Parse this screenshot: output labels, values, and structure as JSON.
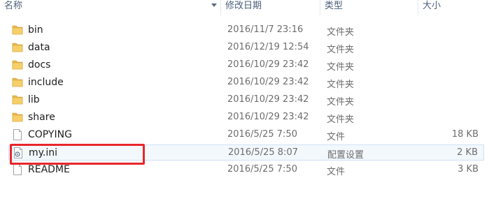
{
  "columns": {
    "name": "名称",
    "date": "修改日期",
    "type": "类型",
    "size": "大小"
  },
  "files": [
    {
      "name": "bin",
      "date": "2016/11/7 23:16",
      "type": "文件夹",
      "size": "",
      "icon": "folder-icon"
    },
    {
      "name": "data",
      "date": "2016/12/19 12:54",
      "type": "文件夹",
      "size": "",
      "icon": "folder-icon"
    },
    {
      "name": "docs",
      "date": "2016/10/29 23:42",
      "type": "文件夹",
      "size": "",
      "icon": "folder-icon"
    },
    {
      "name": "include",
      "date": "2016/10/29 23:42",
      "type": "文件夹",
      "size": "",
      "icon": "folder-icon"
    },
    {
      "name": "lib",
      "date": "2016/10/29 23:42",
      "type": "文件夹",
      "size": "",
      "icon": "folder-icon"
    },
    {
      "name": "share",
      "date": "2016/10/29 23:42",
      "type": "文件夹",
      "size": "",
      "icon": "folder-icon"
    },
    {
      "name": "COPYING",
      "date": "2016/5/25 7:50",
      "type": "文件",
      "size": "18 KB",
      "icon": "file-icon"
    },
    {
      "name": "my.ini",
      "date": "2016/5/25 8:07",
      "type": "配置设置",
      "size": "2 KB",
      "icon": "config-file-icon"
    },
    {
      "name": "README",
      "date": "2016/5/25 7:50",
      "type": "文件",
      "size": "3 KB",
      "icon": "file-icon"
    }
  ],
  "colors": {
    "highlight": "#e8262a",
    "folder": "#e8b84a",
    "selection": "#f3f8fd"
  }
}
